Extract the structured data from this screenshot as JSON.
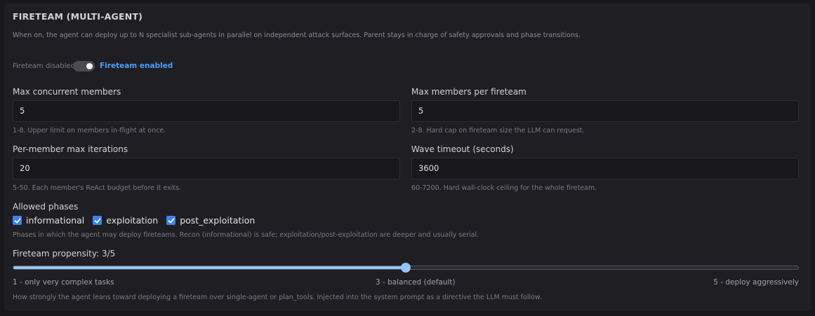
{
  "section": {
    "title": "FIRETEAM (MULTI-AGENT)",
    "description": "When on, the agent can deploy up to N specialist sub-agents in parallel on independent attack surfaces. Parent stays in charge of safety approvals and phase transitions."
  },
  "toggle": {
    "off_label": "Fireteam disabled",
    "on_label": "Fireteam enabled",
    "enabled": true
  },
  "fields": {
    "max_concurrent": {
      "label": "Max concurrent members",
      "value": "5",
      "hint": "1-8. Upper limit on members in-flight at once."
    },
    "max_per_fireteam": {
      "label": "Max members per fireteam",
      "value": "5",
      "hint": "2-8. Hard cap on fireteam size the LLM can request."
    },
    "per_member_iterations": {
      "label": "Per-member max iterations",
      "value": "20",
      "hint": "5-50. Each member's ReAct budget before it exits."
    },
    "wave_timeout": {
      "label": "Wave timeout (seconds)",
      "value": "3600",
      "hint": "60-7200. Hard wall-clock ceiling for the whole fireteam."
    }
  },
  "phases": {
    "label": "Allowed phases",
    "options": [
      {
        "label": "informational",
        "checked": true
      },
      {
        "label": "exploitation",
        "checked": true
      },
      {
        "label": "post_exploitation",
        "checked": true
      }
    ],
    "hint": "Phases in which the agent may deploy fireteams. Recon (informational) is safe; exploitation/post-exploitation are deeper and usually serial."
  },
  "propensity": {
    "label": "Fireteam propensity: 3/5",
    "value": 3,
    "min": 1,
    "max": 5,
    "scale_min_label": "1 - only very complex tasks",
    "scale_mid_label": "3 - balanced (default)",
    "scale_max_label": "5 - deploy aggressively",
    "hint": "How strongly the agent leans toward deploying a fireteam over single-agent or plan_tools. Injected into the system prompt as a directive the LLM must follow."
  }
}
